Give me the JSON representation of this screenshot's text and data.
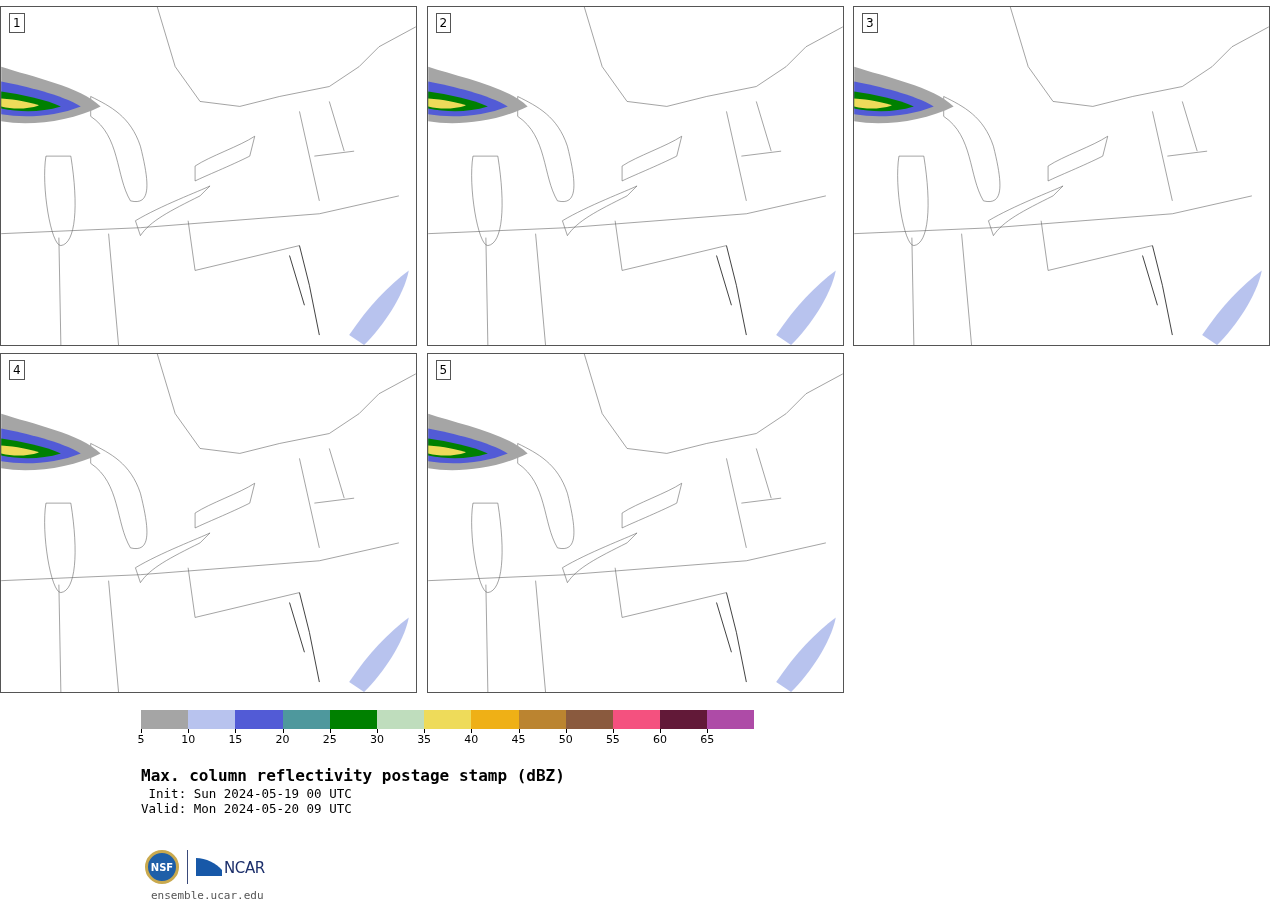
{
  "panels": [
    {
      "label": "1"
    },
    {
      "label": "2"
    },
    {
      "label": "3"
    },
    {
      "label": "4"
    },
    {
      "label": "5"
    }
  ],
  "colorbar": {
    "segments": [
      {
        "color": "#a5a5a5",
        "tick": "5"
      },
      {
        "color": "#b8c3ee",
        "tick": "10"
      },
      {
        "color": "#525bd6",
        "tick": "15"
      },
      {
        "color": "#4e989d",
        "tick": "20"
      },
      {
        "color": "#008000",
        "tick": "25"
      },
      {
        "color": "#bfddbd",
        "tick": "30"
      },
      {
        "color": "#eedb5a",
        "tick": "35"
      },
      {
        "color": "#efb016",
        "tick": "40"
      },
      {
        "color": "#bb8430",
        "tick": "45"
      },
      {
        "color": "#8a5a3e",
        "tick": "50"
      },
      {
        "color": "#f4517f",
        "tick": "55"
      },
      {
        "color": "#621938",
        "tick": "60"
      },
      {
        "color": "#ae4ba7",
        "tick": "65"
      }
    ]
  },
  "title": "Max. column reflectivity postage stamp (dBZ)",
  "init": " Init: Sun 2024-05-19 00 UTC",
  "valid": "Valid: Mon 2024-05-20 09 UTC",
  "logos": {
    "nsf": "NSF",
    "ncar": "NCAR"
  },
  "footer": "ensemble.ucar.edu"
}
